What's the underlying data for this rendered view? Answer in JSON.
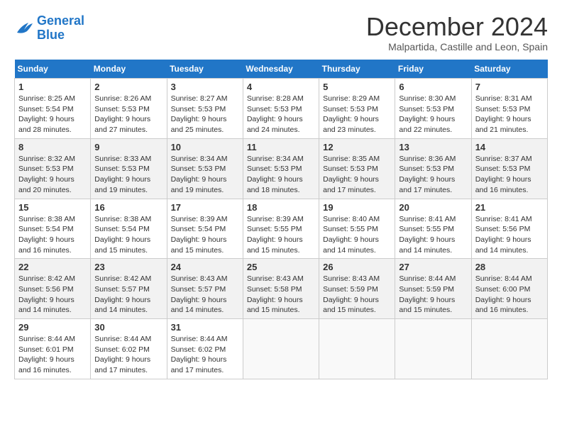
{
  "header": {
    "logo_line1": "General",
    "logo_line2": "Blue",
    "month_year": "December 2024",
    "location": "Malpartida, Castille and Leon, Spain"
  },
  "weekdays": [
    "Sunday",
    "Monday",
    "Tuesday",
    "Wednesday",
    "Thursday",
    "Friday",
    "Saturday"
  ],
  "weeks": [
    [
      {
        "day": "1",
        "info": "Sunrise: 8:25 AM\nSunset: 5:54 PM\nDaylight: 9 hours and 28 minutes."
      },
      {
        "day": "2",
        "info": "Sunrise: 8:26 AM\nSunset: 5:53 PM\nDaylight: 9 hours and 27 minutes."
      },
      {
        "day": "3",
        "info": "Sunrise: 8:27 AM\nSunset: 5:53 PM\nDaylight: 9 hours and 25 minutes."
      },
      {
        "day": "4",
        "info": "Sunrise: 8:28 AM\nSunset: 5:53 PM\nDaylight: 9 hours and 24 minutes."
      },
      {
        "day": "5",
        "info": "Sunrise: 8:29 AM\nSunset: 5:53 PM\nDaylight: 9 hours and 23 minutes."
      },
      {
        "day": "6",
        "info": "Sunrise: 8:30 AM\nSunset: 5:53 PM\nDaylight: 9 hours and 22 minutes."
      },
      {
        "day": "7",
        "info": "Sunrise: 8:31 AM\nSunset: 5:53 PM\nDaylight: 9 hours and 21 minutes."
      }
    ],
    [
      {
        "day": "8",
        "info": "Sunrise: 8:32 AM\nSunset: 5:53 PM\nDaylight: 9 hours and 20 minutes."
      },
      {
        "day": "9",
        "info": "Sunrise: 8:33 AM\nSunset: 5:53 PM\nDaylight: 9 hours and 19 minutes."
      },
      {
        "day": "10",
        "info": "Sunrise: 8:34 AM\nSunset: 5:53 PM\nDaylight: 9 hours and 19 minutes."
      },
      {
        "day": "11",
        "info": "Sunrise: 8:34 AM\nSunset: 5:53 PM\nDaylight: 9 hours and 18 minutes."
      },
      {
        "day": "12",
        "info": "Sunrise: 8:35 AM\nSunset: 5:53 PM\nDaylight: 9 hours and 17 minutes."
      },
      {
        "day": "13",
        "info": "Sunrise: 8:36 AM\nSunset: 5:53 PM\nDaylight: 9 hours and 17 minutes."
      },
      {
        "day": "14",
        "info": "Sunrise: 8:37 AM\nSunset: 5:53 PM\nDaylight: 9 hours and 16 minutes."
      }
    ],
    [
      {
        "day": "15",
        "info": "Sunrise: 8:38 AM\nSunset: 5:54 PM\nDaylight: 9 hours and 16 minutes."
      },
      {
        "day": "16",
        "info": "Sunrise: 8:38 AM\nSunset: 5:54 PM\nDaylight: 9 hours and 15 minutes."
      },
      {
        "day": "17",
        "info": "Sunrise: 8:39 AM\nSunset: 5:54 PM\nDaylight: 9 hours and 15 minutes."
      },
      {
        "day": "18",
        "info": "Sunrise: 8:39 AM\nSunset: 5:55 PM\nDaylight: 9 hours and 15 minutes."
      },
      {
        "day": "19",
        "info": "Sunrise: 8:40 AM\nSunset: 5:55 PM\nDaylight: 9 hours and 14 minutes."
      },
      {
        "day": "20",
        "info": "Sunrise: 8:41 AM\nSunset: 5:55 PM\nDaylight: 9 hours and 14 minutes."
      },
      {
        "day": "21",
        "info": "Sunrise: 8:41 AM\nSunset: 5:56 PM\nDaylight: 9 hours and 14 minutes."
      }
    ],
    [
      {
        "day": "22",
        "info": "Sunrise: 8:42 AM\nSunset: 5:56 PM\nDaylight: 9 hours and 14 minutes."
      },
      {
        "day": "23",
        "info": "Sunrise: 8:42 AM\nSunset: 5:57 PM\nDaylight: 9 hours and 14 minutes."
      },
      {
        "day": "24",
        "info": "Sunrise: 8:43 AM\nSunset: 5:57 PM\nDaylight: 9 hours and 14 minutes."
      },
      {
        "day": "25",
        "info": "Sunrise: 8:43 AM\nSunset: 5:58 PM\nDaylight: 9 hours and 15 minutes."
      },
      {
        "day": "26",
        "info": "Sunrise: 8:43 AM\nSunset: 5:59 PM\nDaylight: 9 hours and 15 minutes."
      },
      {
        "day": "27",
        "info": "Sunrise: 8:44 AM\nSunset: 5:59 PM\nDaylight: 9 hours and 15 minutes."
      },
      {
        "day": "28",
        "info": "Sunrise: 8:44 AM\nSunset: 6:00 PM\nDaylight: 9 hours and 16 minutes."
      }
    ],
    [
      {
        "day": "29",
        "info": "Sunrise: 8:44 AM\nSunset: 6:01 PM\nDaylight: 9 hours and 16 minutes."
      },
      {
        "day": "30",
        "info": "Sunrise: 8:44 AM\nSunset: 6:02 PM\nDaylight: 9 hours and 17 minutes."
      },
      {
        "day": "31",
        "info": "Sunrise: 8:44 AM\nSunset: 6:02 PM\nDaylight: 9 hours and 17 minutes."
      },
      null,
      null,
      null,
      null
    ]
  ]
}
